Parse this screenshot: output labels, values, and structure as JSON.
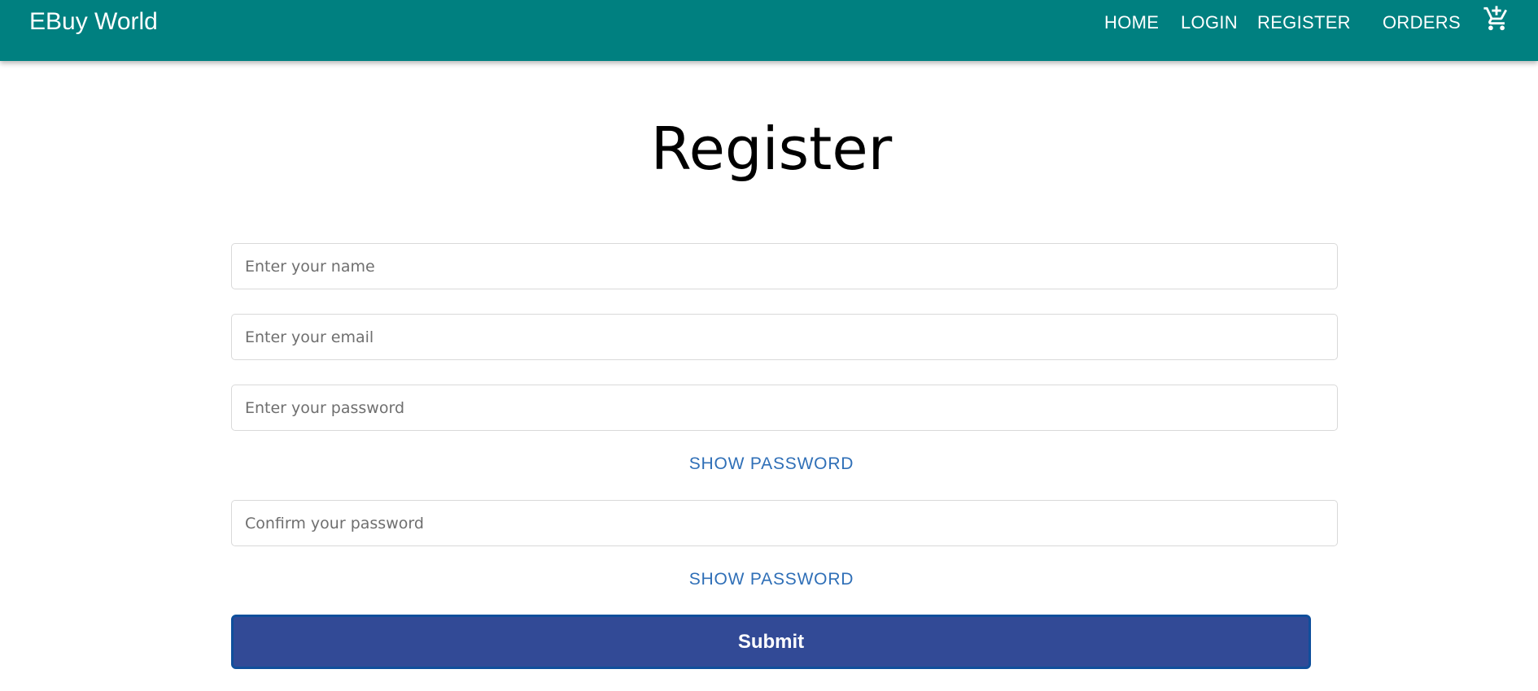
{
  "navbar": {
    "brand": "EBuy World",
    "links": [
      "HOME",
      "LOGIN",
      "REGISTER",
      "ORDERS"
    ],
    "cart_icon": "add-shopping-cart-icon"
  },
  "page": {
    "title": "Register"
  },
  "form": {
    "name_placeholder": "Enter your name",
    "email_placeholder": "Enter your email",
    "password_placeholder": "Enter your password",
    "confirm_placeholder": "Confirm your password",
    "show_password_label": "SHOW PASSWORD",
    "show_confirm_label": "SHOW PASSWORD",
    "submit_label": "Submit"
  },
  "colors": {
    "navbar_bg": "#008080",
    "link_blue": "#2f6fb7",
    "submit_bg": "#324a96"
  }
}
